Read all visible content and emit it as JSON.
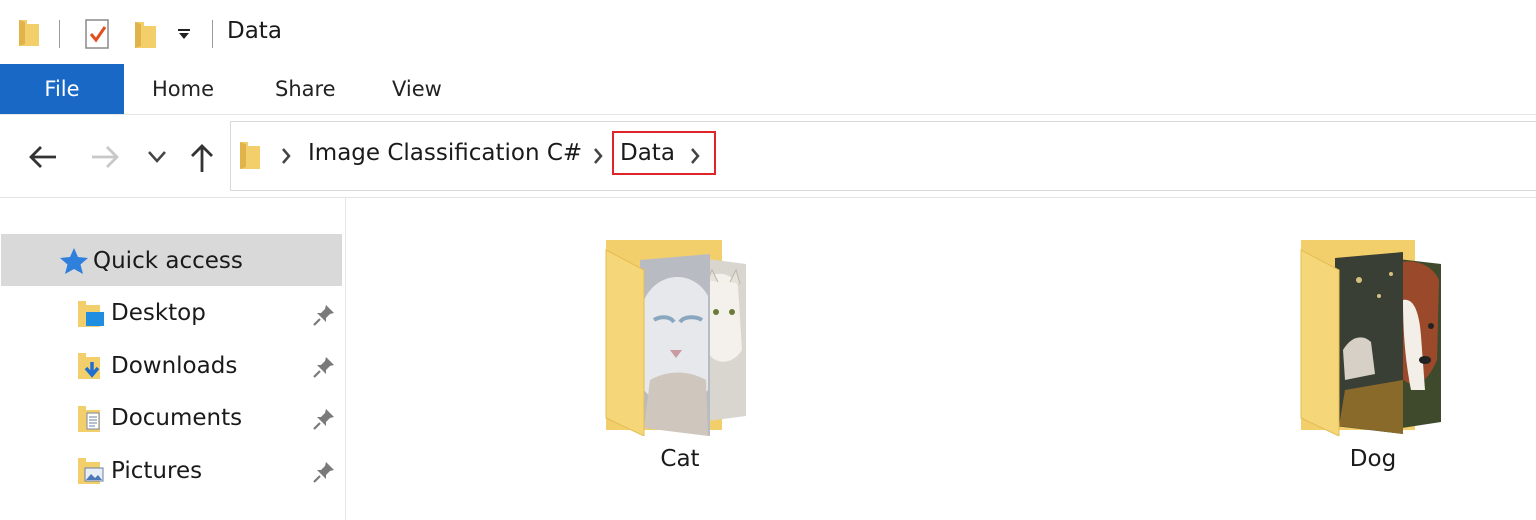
{
  "window": {
    "title": "Data"
  },
  "ribbon": {
    "tabs": [
      {
        "label": "File",
        "active": true
      },
      {
        "label": "Home"
      },
      {
        "label": "Share"
      },
      {
        "label": "View"
      }
    ]
  },
  "address_bar": {
    "breadcrumb": [
      {
        "label": "Image Classification C#"
      },
      {
        "label": "Data",
        "highlighted": true
      }
    ]
  },
  "nav_pane": {
    "quick_access": {
      "label": "Quick access",
      "selected": true
    },
    "items": [
      {
        "label": "Desktop",
        "icon": "desktop-folder-icon",
        "pinned": true
      },
      {
        "label": "Downloads",
        "icon": "downloads-folder-icon",
        "pinned": true
      },
      {
        "label": "Documents",
        "icon": "documents-folder-icon",
        "pinned": true
      },
      {
        "label": "Pictures",
        "icon": "pictures-folder-icon",
        "pinned": true
      }
    ]
  },
  "content": {
    "folders": [
      {
        "name": "Cat"
      },
      {
        "name": "Dog"
      }
    ]
  },
  "colors": {
    "accent": "#1a68c6",
    "selection": "#d9d9d9",
    "highlight_box": "#e0242c",
    "folder": "#f2cf6b"
  }
}
